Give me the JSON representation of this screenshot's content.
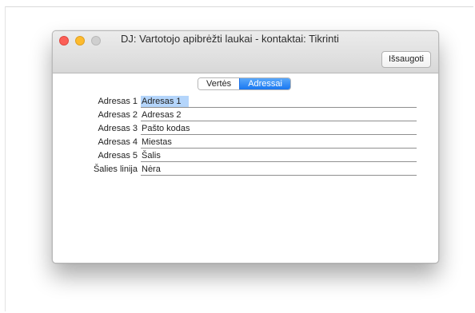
{
  "window": {
    "title": "DJ: Vartotojo apibrėžti laukai - kontaktai: Tikrinti",
    "save_button": "Išsaugoti"
  },
  "tabs": [
    {
      "label": "Vertės",
      "active": false
    },
    {
      "label": "Adressai",
      "active": true
    }
  ],
  "fields": [
    {
      "label": "Adresas 1",
      "value": "Adresas 1",
      "selected": true
    },
    {
      "label": "Adresas 2",
      "value": "Adresas 2",
      "selected": false
    },
    {
      "label": "Adresas 3",
      "value": "Pašto kodas",
      "selected": false
    },
    {
      "label": "Adresas 4",
      "value": "Miestas",
      "selected": false
    },
    {
      "label": "Adresas 5",
      "value": "Šalis",
      "selected": false
    },
    {
      "label": "Šalies linija",
      "value": "Nėra",
      "selected": false
    }
  ],
  "colors": {
    "accent": "#1977f1",
    "selection": "#b4d5fb",
    "close": "#fc5f57",
    "minimize": "#fdbb2e",
    "zoom_disabled": "#cfcfcf"
  }
}
